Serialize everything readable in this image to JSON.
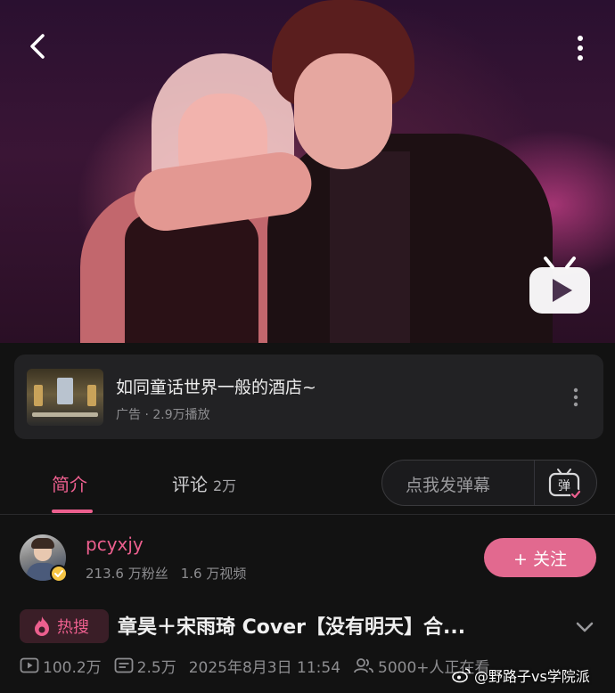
{
  "video": {
    "player_logo": "bilibili-tv-icon"
  },
  "ad": {
    "title": "如同童话世界一般的酒店~",
    "meta": "广告 · 2.9万播放"
  },
  "tabs": {
    "intro": "简介",
    "comments": "评论",
    "comments_count": "2万"
  },
  "danmaku": {
    "placeholder": "点我发弹幕",
    "toggle_label": "弹"
  },
  "uploader": {
    "name": "pcyxjy",
    "fans": "213.6 万粉丝",
    "videos": "1.6 万视频",
    "follow_label": "+ 关注"
  },
  "title": {
    "badge": "热搜",
    "text": "章昊＋宋雨琦 Cover【没有明天】合..."
  },
  "stats": {
    "plays": "100.2万",
    "danmaku": "2.5万",
    "date": "2025年8月3日 11:54",
    "watching": "5000+人正在看"
  },
  "watermark": "@野路子vs学院派",
  "colors": {
    "accent": "#ec5f8e",
    "follow_bg": "#e2698f",
    "background": "#121212"
  }
}
